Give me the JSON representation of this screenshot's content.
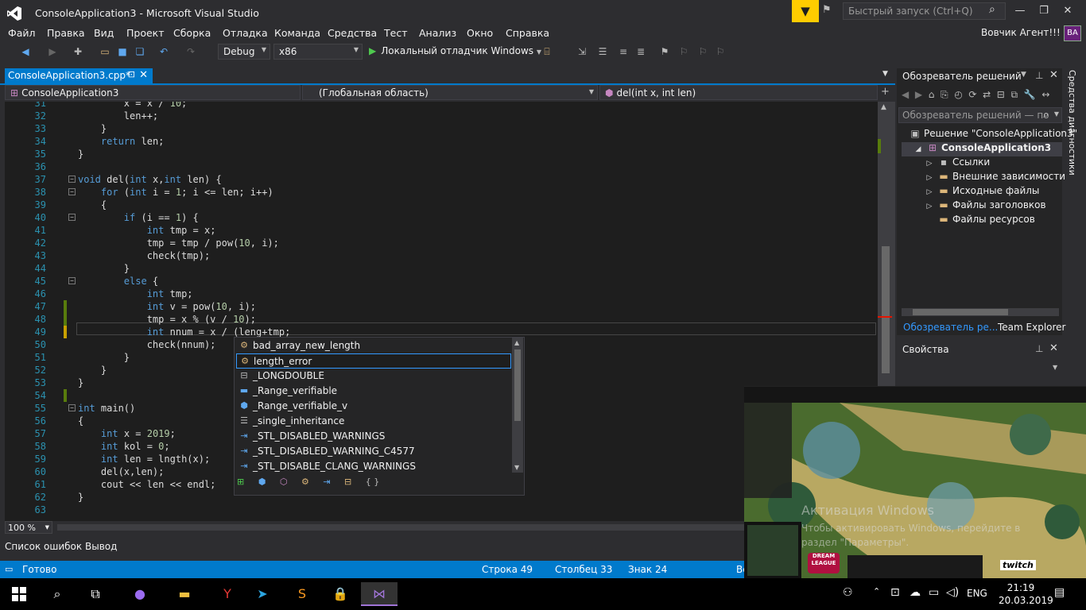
{
  "window": {
    "title": "ConsoleApplication3 - Microsoft Visual Studio",
    "quick_launch_placeholder": "Быстрый запуск (Ctrl+Q)"
  },
  "menu": [
    "Файл",
    "Правка",
    "Вид",
    "Проект",
    "Сборка",
    "Отладка",
    "Команда",
    "Средства",
    "Тест",
    "Анализ",
    "Окно",
    "Справка"
  ],
  "user": {
    "name": "Вовчик Агент!!!",
    "initials": "BA"
  },
  "toolbar": {
    "config": "Debug",
    "platform": "x86",
    "run_label": "Локальный отладчик Windows"
  },
  "document": {
    "tab": "ConsoleApplication3.cpp*",
    "project_scope": "ConsoleApplication3",
    "global_scope": "(Глобальная область)",
    "function_scope": "del(int x, int len)"
  },
  "code": [
    {
      "n": "31",
      "t": "        x = x / 10;"
    },
    {
      "n": "32",
      "t": "        len++;"
    },
    {
      "n": "33",
      "t": "    }"
    },
    {
      "n": "34",
      "t": "    return len;"
    },
    {
      "n": "35",
      "t": "}"
    },
    {
      "n": "36",
      "t": ""
    },
    {
      "n": "37",
      "t": "void del(int x,int len) {"
    },
    {
      "n": "38",
      "t": "    for (int i = 1; i <= len; i++)"
    },
    {
      "n": "39",
      "t": "    {"
    },
    {
      "n": "40",
      "t": "        if (i == 1) {"
    },
    {
      "n": "41",
      "t": "            int tmp = x;"
    },
    {
      "n": "42",
      "t": "            tmp = tmp / pow(10, i);"
    },
    {
      "n": "43",
      "t": "            check(tmp);"
    },
    {
      "n": "44",
      "t": "        }"
    },
    {
      "n": "45",
      "t": "        else {"
    },
    {
      "n": "46",
      "t": "            int tmp;"
    },
    {
      "n": "47",
      "t": "            int v = pow(10, i);"
    },
    {
      "n": "48",
      "t": "            tmp = x % (v / 10);"
    },
    {
      "n": "49",
      "t": "            int nnum = x / (leng+tmp;"
    },
    {
      "n": "50",
      "t": "            check(nnum);"
    },
    {
      "n": "51",
      "t": "        }"
    },
    {
      "n": "52",
      "t": "    }"
    },
    {
      "n": "53",
      "t": "}"
    },
    {
      "n": "54",
      "t": ""
    },
    {
      "n": "55",
      "t": "int main()"
    },
    {
      "n": "56",
      "t": "{"
    },
    {
      "n": "57",
      "t": "    int x = 2019;"
    },
    {
      "n": "58",
      "t": "    int kol = 0;"
    },
    {
      "n": "59",
      "t": "    int len = lngth(x);"
    },
    {
      "n": "60",
      "t": "    del(x,len);"
    },
    {
      "n": "61",
      "t": "    cout << len << endl;"
    },
    {
      "n": "62",
      "t": "}"
    },
    {
      "n": "63",
      "t": ""
    }
  ],
  "autocomplete": {
    "items": [
      {
        "label": "bad_array_new_length",
        "icon": "class-icon"
      },
      {
        "label": "length_error",
        "icon": "class-icon",
        "selected": true
      },
      {
        "label": "_LONGDOUBLE",
        "icon": "typedef-icon"
      },
      {
        "label": "_Range_verifiable",
        "icon": "struct-icon"
      },
      {
        "label": "_Range_verifiable_v",
        "icon": "variable-icon"
      },
      {
        "label": "_single_inheritance",
        "icon": "keyword-icon"
      },
      {
        "label": "_STL_DISABLED_WARNINGS",
        "icon": "macro-icon"
      },
      {
        "label": "_STL_DISABLED_WARNING_C4577",
        "icon": "macro-icon"
      },
      {
        "label": "_STL_DISABLE_CLANG_WARNINGS",
        "icon": "macro-icon"
      }
    ],
    "filters": [
      "⊞",
      "⬢",
      "⬡",
      "⚙",
      "⇥",
      "⊟",
      "{ }"
    ]
  },
  "editor_footer": {
    "zoom": "100 %"
  },
  "bottom_tabs": [
    "Список ошибок",
    "Вывод"
  ],
  "status": {
    "ready": "Готово",
    "line": "Строка 49",
    "col": "Столбец 33",
    "char": "Знак 24",
    "extra": "Вс"
  },
  "solution": {
    "header": "Обозреватель решений",
    "search_placeholder": "Обозреватель решений — по",
    "tree": [
      {
        "label": "Решение \"ConsoleApplication3\"",
        "indent": 0,
        "icon": "solution-icon",
        "bold": false
      },
      {
        "label": "ConsoleApplication3",
        "indent": 1,
        "icon": "project-icon",
        "bold": true
      },
      {
        "label": "Ссылки",
        "indent": 2,
        "icon": "references-icon",
        "bold": false
      },
      {
        "label": "Внешние зависимости",
        "indent": 2,
        "icon": "folder-icon",
        "bold": false
      },
      {
        "label": "Исходные файлы",
        "indent": 2,
        "icon": "folder-icon",
        "bold": false
      },
      {
        "label": "Файлы заголовков",
        "indent": 2,
        "icon": "folder-icon",
        "bold": false
      },
      {
        "label": "Файлы ресурсов",
        "indent": 2,
        "icon": "folder-icon",
        "bold": false
      }
    ],
    "tab_active": "Обозреватель ре...",
    "tab_other": "Team Explorer"
  },
  "properties": {
    "header": "Свойства"
  },
  "diagnostics_label": "Средства диагностики",
  "stream": {
    "watermark_title": "Активация Windows",
    "watermark_text1": "Чтобы активировать Windows, перейдите в",
    "watermark_text2": "раздел \"Параметры\".",
    "twitch": "twitch",
    "dream": "DREAM LEAGUE"
  },
  "taskbar": {
    "lang": "ENG",
    "time": "21:19",
    "date": "20.03.2019"
  },
  "colors": {
    "accent": "#007acc",
    "background": "#2d2d30",
    "editor": "#1e1e1e"
  }
}
